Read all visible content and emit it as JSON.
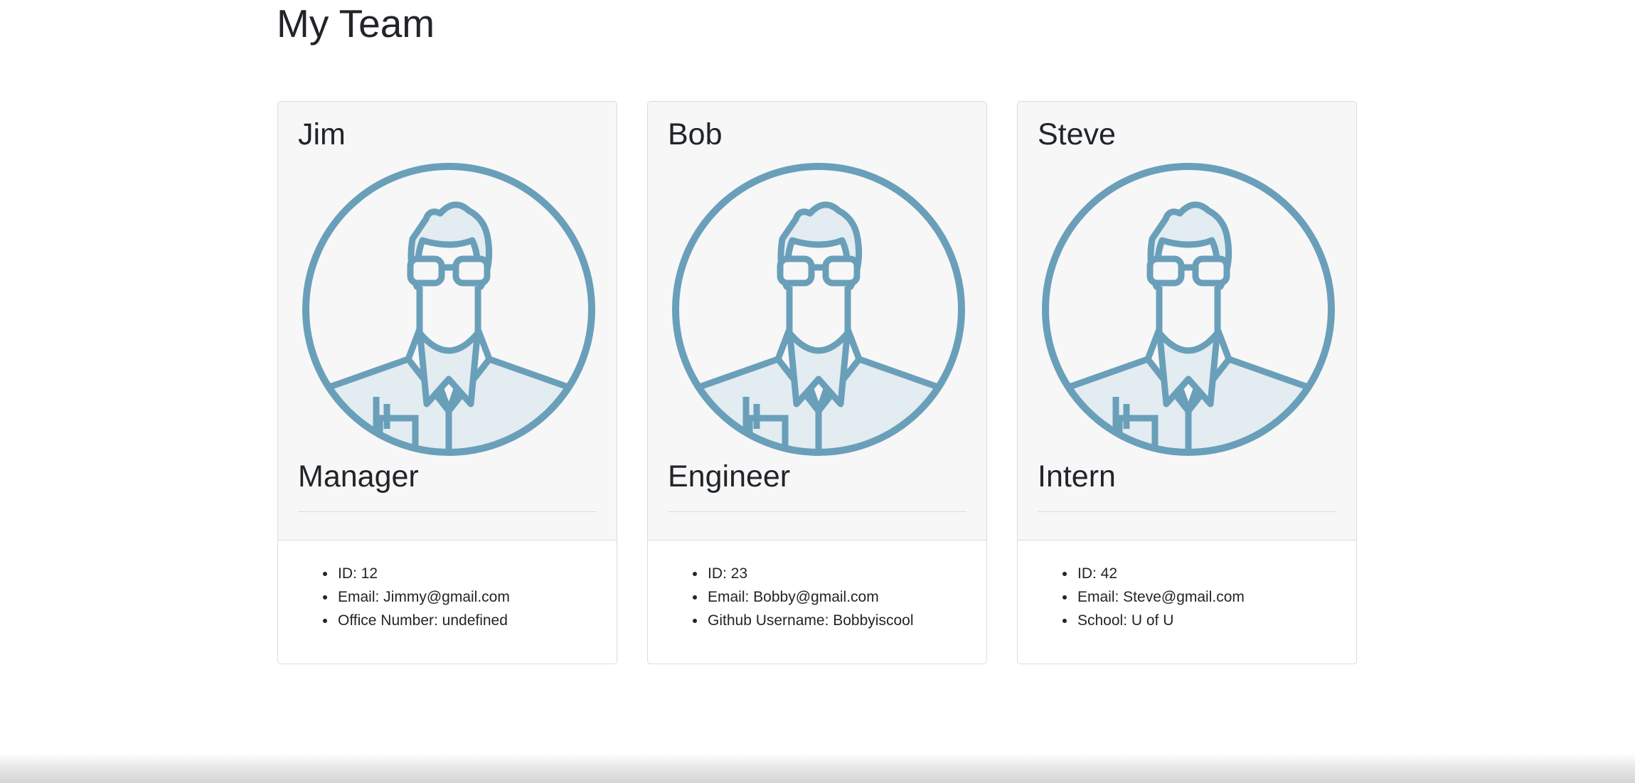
{
  "page": {
    "title": "My Team"
  },
  "team": [
    {
      "name": "Jim",
      "role": "Manager",
      "avatar_icon": "person-glasses-icon",
      "details": [
        "ID: 12",
        "Email: Jimmy@gmail.com",
        "Office Number: undefined"
      ]
    },
    {
      "name": "Bob",
      "role": "Engineer",
      "avatar_icon": "person-glasses-icon",
      "details": [
        "ID: 23",
        "Email: Bobby@gmail.com",
        "Github Username: Bobbyiscool"
      ]
    },
    {
      "name": "Steve",
      "role": "Intern",
      "avatar_icon": "person-glasses-icon",
      "details": [
        "ID: 42",
        "Email: Steve@gmail.com",
        "School: U of U"
      ]
    }
  ],
  "colors": {
    "avatar_stroke": "#6a9fba",
    "avatar_fill": "#e2ecf1",
    "card_header_bg": "#f7f7f7",
    "border": "#dcdcdc",
    "text": "#212529"
  }
}
